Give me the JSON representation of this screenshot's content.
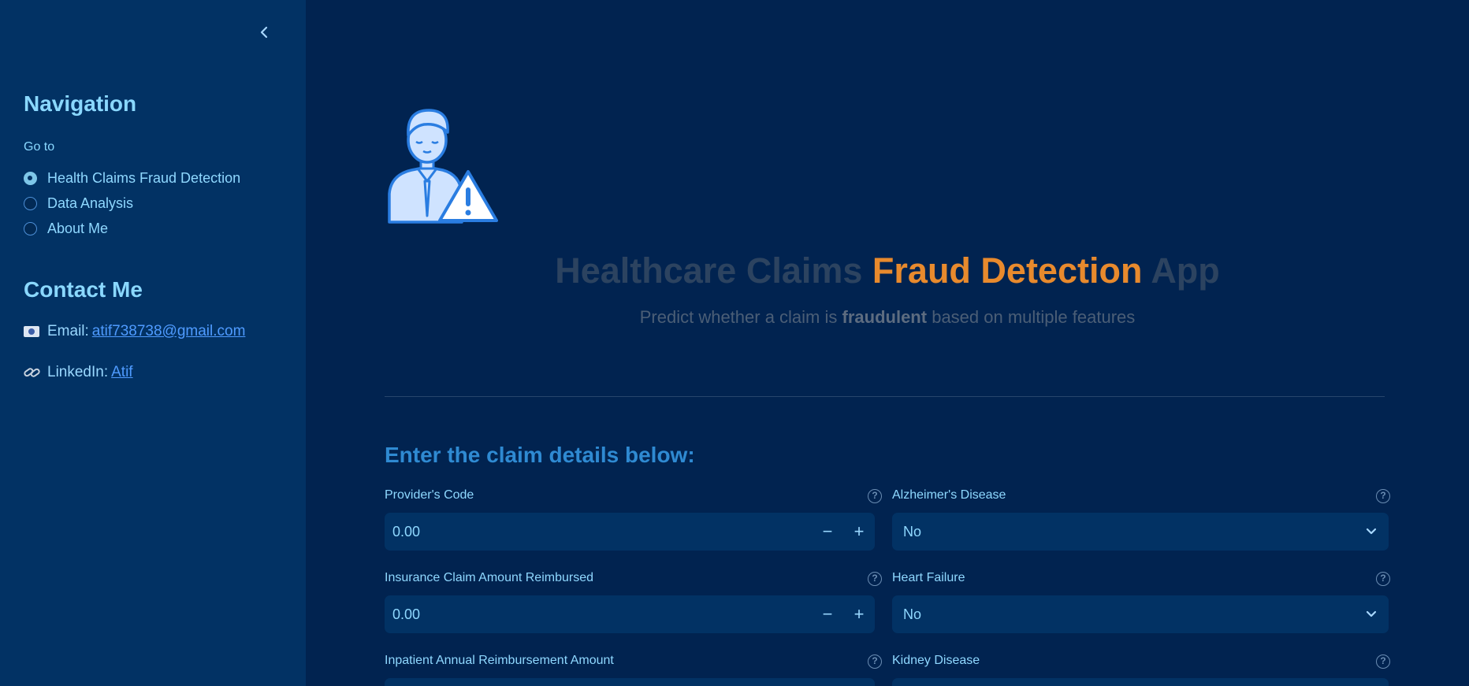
{
  "sidebar": {
    "nav_title": "Navigation",
    "goto_label": "Go to",
    "pages": [
      {
        "label": "Health Claims Fraud Detection",
        "selected": true
      },
      {
        "label": "Data Analysis",
        "selected": false
      },
      {
        "label": "About Me",
        "selected": false
      }
    ],
    "contact_title": "Contact Me",
    "email_label": "Email:",
    "email_value": "atif738738@gmail.com",
    "linkedin_label": "LinkedIn:",
    "linkedin_value": "Atif"
  },
  "header": {
    "title_part1": "Healthcare Claims",
    "title_accent": "Fraud Detection",
    "title_part2": "App",
    "subtitle_part1": "Predict whether a claim is",
    "subtitle_bold": "fraudulent",
    "subtitle_part2": "based on multiple features"
  },
  "form": {
    "header": "Enter the claim details below:",
    "numeric_fields": [
      {
        "label": "Provider's Code",
        "value": "0.00"
      },
      {
        "label": "Insurance Claim Amount Reimbursed",
        "value": "0.00"
      },
      {
        "label": "Inpatient Annual Reimbursement Amount",
        "value": ""
      }
    ],
    "select_fields": [
      {
        "label": "Alzheimer's Disease",
        "value": "No"
      },
      {
        "label": "Heart Failure",
        "value": "No"
      },
      {
        "label": "Kidney Disease",
        "value": ""
      }
    ],
    "help_glyph": "?",
    "minus_glyph": "−",
    "plus_glyph": "+"
  },
  "colors": {
    "background": "#012350",
    "sidebar": "#023264",
    "accent": "#e88a2d",
    "heading": "#2f8ad2",
    "text": "#8fd8ff"
  }
}
